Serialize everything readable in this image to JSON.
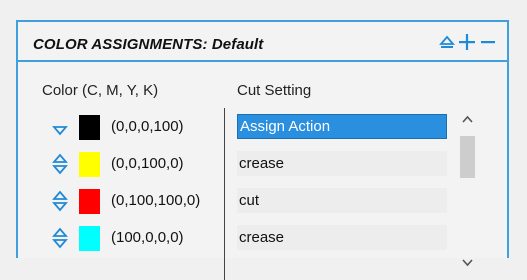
{
  "panel": {
    "title": "COLOR ASSIGNMENTS: Default",
    "accent_color": "#3fa0dc",
    "icons": [
      "eject-icon",
      "plus-icon",
      "minus-icon"
    ]
  },
  "columns": {
    "color_header": "Color (C, M, Y, K)",
    "cut_header": "Cut Setting"
  },
  "rows": [
    {
      "cmyk": "(0,0,0,100)",
      "swatch": "#000000",
      "cut": "Assign Action",
      "selected": true,
      "arrows": "down"
    },
    {
      "cmyk": "(0,0,100,0)",
      "swatch": "#ffff00",
      "cut": "crease",
      "selected": false,
      "arrows": "both"
    },
    {
      "cmyk": "(0,100,100,0)",
      "swatch": "#ff0000",
      "cut": "cut",
      "selected": false,
      "arrows": "both"
    },
    {
      "cmyk": "(100,0,0,0)",
      "swatch": "#00ffff",
      "cut": "crease",
      "selected": false,
      "arrows": "both"
    }
  ]
}
